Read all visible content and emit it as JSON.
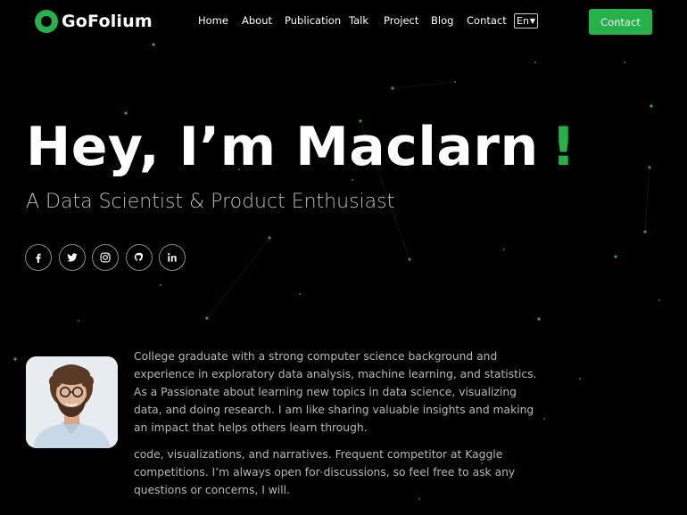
{
  "brand": {
    "name": "GoFolium",
    "accent": "#26b14a"
  },
  "nav": {
    "items": [
      {
        "label": "Home"
      },
      {
        "label": "About"
      },
      {
        "label": "Publication"
      },
      {
        "label": "Talk"
      },
      {
        "label": "Project"
      },
      {
        "label": "Blog"
      },
      {
        "label": "Contact"
      }
    ],
    "language": "En",
    "contact_button": "Contact"
  },
  "hero": {
    "title": "Hey, I’m Maclarn",
    "title_accent": "!",
    "subtitle": "A Data Scientist & Product Enthusiast"
  },
  "socials": [
    {
      "icon": "facebook-icon"
    },
    {
      "icon": "twitter-icon"
    },
    {
      "icon": "instagram-icon"
    },
    {
      "icon": "github-icon"
    },
    {
      "icon": "linkedin-icon"
    }
  ],
  "about": {
    "paragraphs": [
      "College graduate with a strong computer science background and experience in exploratory data analysis, machine learning, and statistics. As a Passionate about learning new topics in data science, visualizing data, and doing research. I am like sharing valuable insights and making an impact that helps others learn through.",
      "code, visualizations, and narratives. Frequent competitor at Kaggle competitions. I’m always open for discussions, so feel free to ask any questions or concerns, I will."
    ]
  }
}
